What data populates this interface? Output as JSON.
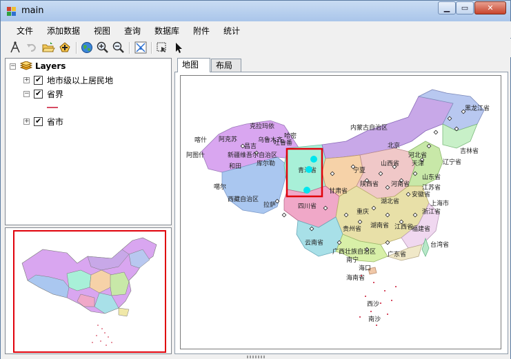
{
  "window": {
    "title": "main"
  },
  "menu": [
    "文件",
    "添加数据",
    "视图",
    "查询",
    "数据库",
    "附件",
    "统计"
  ],
  "toolbar": {
    "icons": [
      "identify-icon",
      "undo-icon",
      "open-folder-icon",
      "add-data-icon",
      "globe-full-extent-icon",
      "zoom-in-icon",
      "zoom-out-icon",
      "pan-icon",
      "select-features-icon",
      "pointer-icon"
    ]
  },
  "toc": {
    "root": "Layers",
    "layers": [
      {
        "name": "地市级以上居民地",
        "checked": true,
        "expanded": false
      },
      {
        "name": "省界",
        "checked": true,
        "expanded": true
      },
      {
        "name": "省市",
        "checked": true,
        "expanded": false
      }
    ]
  },
  "tabs": [
    "地图",
    "布局"
  ],
  "active_tab": "地图",
  "map": {
    "labels": [
      "黑龙江省",
      "内蒙古自治区",
      "吉林省",
      "辽宁省",
      "新疆维吾尔自治区",
      "阿图什",
      "克拉玛依",
      "和田",
      "西藏自治区",
      "噶尔",
      "青海省",
      "甘肃省",
      "四川省",
      "北京",
      "山西省",
      "河北省",
      "山东省",
      "河南省",
      "陕西省",
      "湖北省",
      "安徽省",
      "江苏省",
      "浙江省",
      "上海市",
      "福建省",
      "台湾省",
      "湖南省",
      "江西省",
      "广东省",
      "广西壮族自治区",
      "海南省",
      "贵州省",
      "云南省",
      "重庆",
      "宁夏",
      "天津",
      "南宁",
      "拉萨",
      "昌吉",
      "乌鲁木齐",
      "吐鲁番",
      "哈密",
      "库尔勒",
      "阿克苏",
      "喀什",
      "海口",
      "西沙",
      "南沙"
    ],
    "colors": {
      "selection": "#e0000a",
      "highlight": "#00e5ee"
    }
  }
}
